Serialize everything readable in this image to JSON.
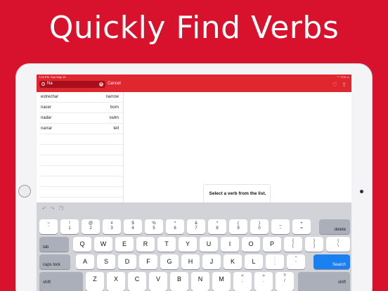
{
  "headline": "Quickly Find Verbs",
  "status": {
    "time": "7:04 PM",
    "date": "Sun May 19",
    "battery": "71%"
  },
  "search": {
    "value": "Na",
    "cancel_label": "Cancel"
  },
  "verbs": [
    {
      "spanish": "estrechar",
      "english": "narrow"
    },
    {
      "spanish": "nacer",
      "english": "born"
    },
    {
      "spanish": "nadar",
      "english": "swim"
    },
    {
      "spanish": "narrar",
      "english": "tell"
    }
  ],
  "detail": {
    "empty_message": "Select a verb from the list."
  },
  "keyboard": {
    "number_row": [
      {
        "top": "~",
        "bot": "`"
      },
      {
        "top": "!",
        "bot": "1"
      },
      {
        "top": "@",
        "bot": "2"
      },
      {
        "top": "#",
        "bot": "3"
      },
      {
        "top": "$",
        "bot": "4"
      },
      {
        "top": "%",
        "bot": "5"
      },
      {
        "top": "^",
        "bot": "6"
      },
      {
        "top": "&",
        "bot": "7"
      },
      {
        "top": "*",
        "bot": "8"
      },
      {
        "top": "(",
        "bot": "9"
      },
      {
        "top": ")",
        "bot": "0"
      },
      {
        "top": "_",
        "bot": "-"
      },
      {
        "top": "+",
        "bot": "="
      }
    ],
    "delete_label": "delete",
    "tab_label": "tab",
    "qwerty_row": [
      "Q",
      "W",
      "E",
      "R",
      "T",
      "Y",
      "U",
      "I",
      "O",
      "P"
    ],
    "qwerty_extra": [
      {
        "top": "{",
        "bot": "["
      },
      {
        "top": "}",
        "bot": "]"
      },
      {
        "top": "|",
        "bot": "\\"
      }
    ],
    "caps_label": "caps lock",
    "home_row": [
      "A",
      "S",
      "D",
      "F",
      "G",
      "H",
      "J",
      "K",
      "L"
    ],
    "home_extra": [
      {
        "top": ":",
        "bot": ";"
      },
      {
        "top": "\"",
        "bot": "'"
      }
    ],
    "search_label": "Search",
    "shift_label": "shift",
    "bottom_row": [
      "Z",
      "X",
      "C",
      "V",
      "B",
      "N",
      "M"
    ],
    "bottom_extra": [
      {
        "top": "<",
        "bot": ","
      },
      {
        "top": ">",
        "bot": "."
      },
      {
        "top": "?",
        "bot": "/"
      }
    ]
  }
}
